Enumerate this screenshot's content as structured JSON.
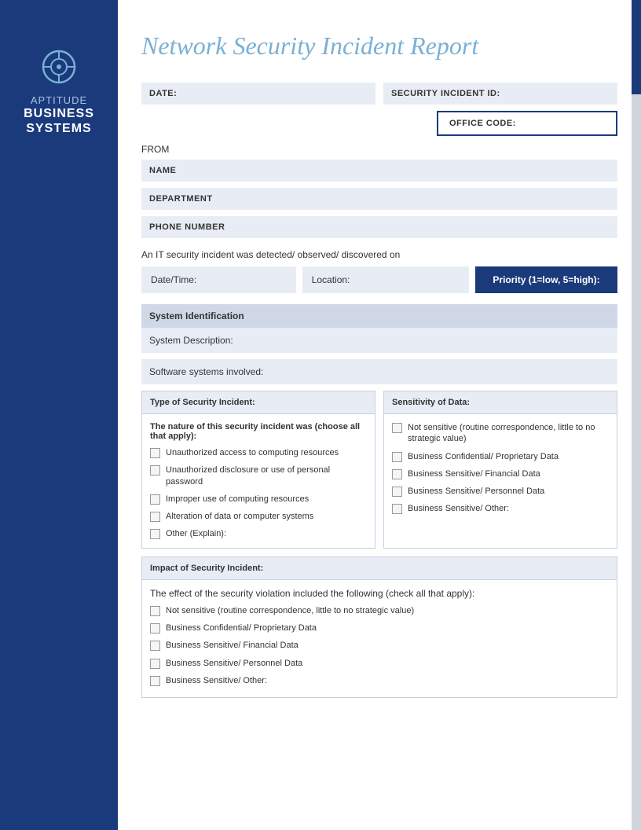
{
  "sidebar": {
    "brand_aptitude": "APTITUDE",
    "brand_line1": "BUSINESS",
    "brand_line2": "SYSTEMS"
  },
  "header": {
    "title": "Network Security Incident Report"
  },
  "form": {
    "date_label": "DATE:",
    "security_id_label": "SECURITY INCIDENT ID:",
    "office_code_label": "OFFICE CODE:",
    "from_label": "FROM",
    "name_label": "NAME",
    "department_label": "DEPARTMENT",
    "phone_label": "PHONE NUMBER",
    "incident_detected_text": "An IT security incident was detected/ observed/ discovered on",
    "date_time_label": "Date/Time:",
    "location_label": "Location:",
    "priority_label": "Priority (1=low, 5=high):",
    "system_identification": "System Identification",
    "system_description_label": "System Description:",
    "software_systems_label": "Software systems involved:",
    "type_of_incident_label": "Type of Security Incident:",
    "nature_text": "The nature of this security incident was (choose all that apply):",
    "type_checkboxes": [
      "Unauthorized access to computing resources",
      "Unauthorized disclosure or use of personal password",
      "Improper use of computing resources",
      "Alteration of data or computer systems",
      "Other (Explain):"
    ],
    "sensitivity_label": "Sensitivity of Data:",
    "sensitivity_checkboxes": [
      "Not sensitive (routine correspondence, little to no strategic value)",
      "Business Confidential/ Proprietary Data",
      "Business Sensitive/ Financial Data",
      "Business Sensitive/ Personnel Data",
      "Business Sensitive/ Other:"
    ],
    "impact_label": "Impact of Security Incident:",
    "impact_desc": "The effect of the security violation included the following (check all that apply):",
    "impact_checkboxes": [
      "Not sensitive (routine correspondence, little to no strategic value)",
      "Business Confidential/ Proprietary Data",
      "Business Sensitive/ Financial Data",
      "Business Sensitive/ Personnel Data",
      "Business Sensitive/ Other:"
    ]
  }
}
